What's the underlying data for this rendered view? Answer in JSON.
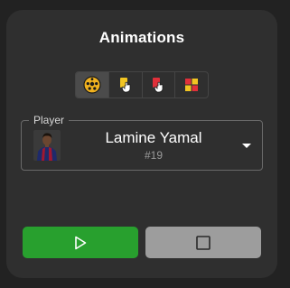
{
  "panel": {
    "title": "Animations"
  },
  "animation_tabs": [
    {
      "icon": "ball-icon",
      "active": true
    },
    {
      "icon": "yellow-card-hand-icon",
      "active": false
    },
    {
      "icon": "red-card-hand-icon",
      "active": false
    },
    {
      "icon": "grid-icon",
      "active": false
    }
  ],
  "player": {
    "label": "Player",
    "name": "Lamine Yamal",
    "number": "#19",
    "avatar": "player-avatar"
  },
  "controls": {
    "play_icon": "play-icon",
    "stop_icon": "stop-icon"
  },
  "colors": {
    "background": "#222222",
    "panel": "#2f2f2f",
    "play": "#28a02e",
    "stop": "#9d9d9d",
    "yellow_card": "#f2c522",
    "red_card": "#e0303a"
  }
}
